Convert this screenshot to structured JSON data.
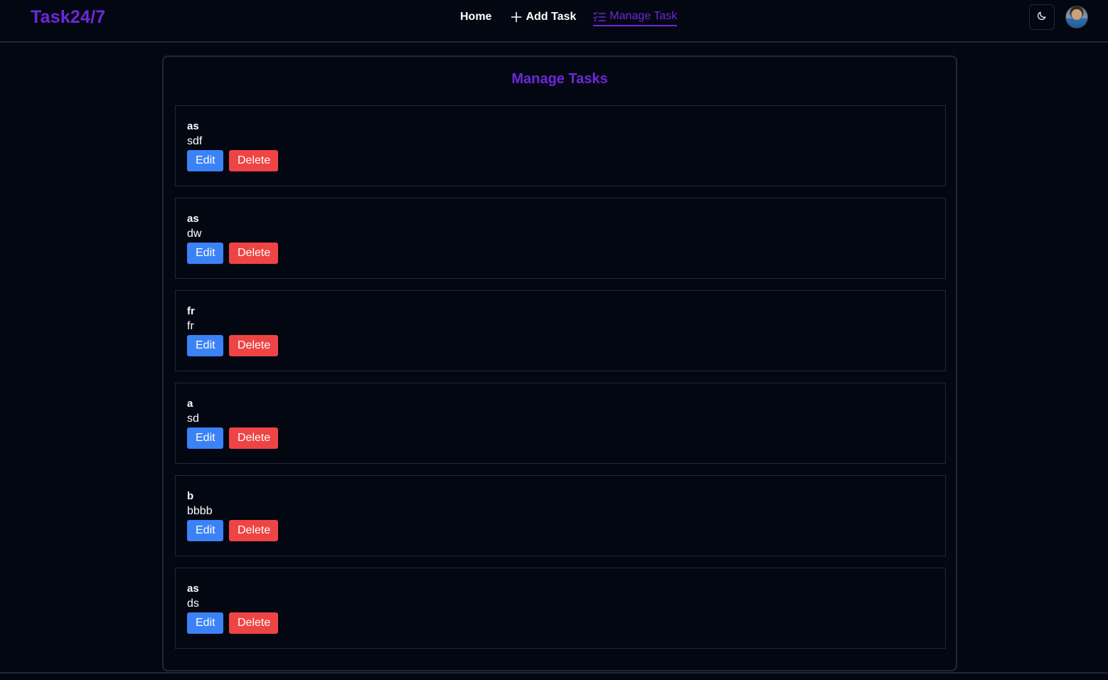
{
  "brand": "Task24/7",
  "nav": {
    "home": "Home",
    "add_task": "Add Task",
    "manage_task": "Manage Task"
  },
  "page": {
    "title": "Manage Tasks"
  },
  "buttons": {
    "edit": "Edit",
    "delete": "Delete"
  },
  "tasks": [
    {
      "title": "as",
      "description": "sdf"
    },
    {
      "title": "as",
      "description": "dw"
    },
    {
      "title": "fr",
      "description": "fr"
    },
    {
      "title": "a",
      "description": "sd"
    },
    {
      "title": "b",
      "description": "bbbb"
    },
    {
      "title": "as",
      "description": "ds"
    }
  ],
  "colors": {
    "background": "#030712",
    "accent": "#6d28d9",
    "edit": "#3b82f6",
    "delete": "#ef4444"
  },
  "icons": {
    "add_task": "plus-icon",
    "manage_task": "list-check-icon",
    "theme_toggle": "moon-icon"
  }
}
